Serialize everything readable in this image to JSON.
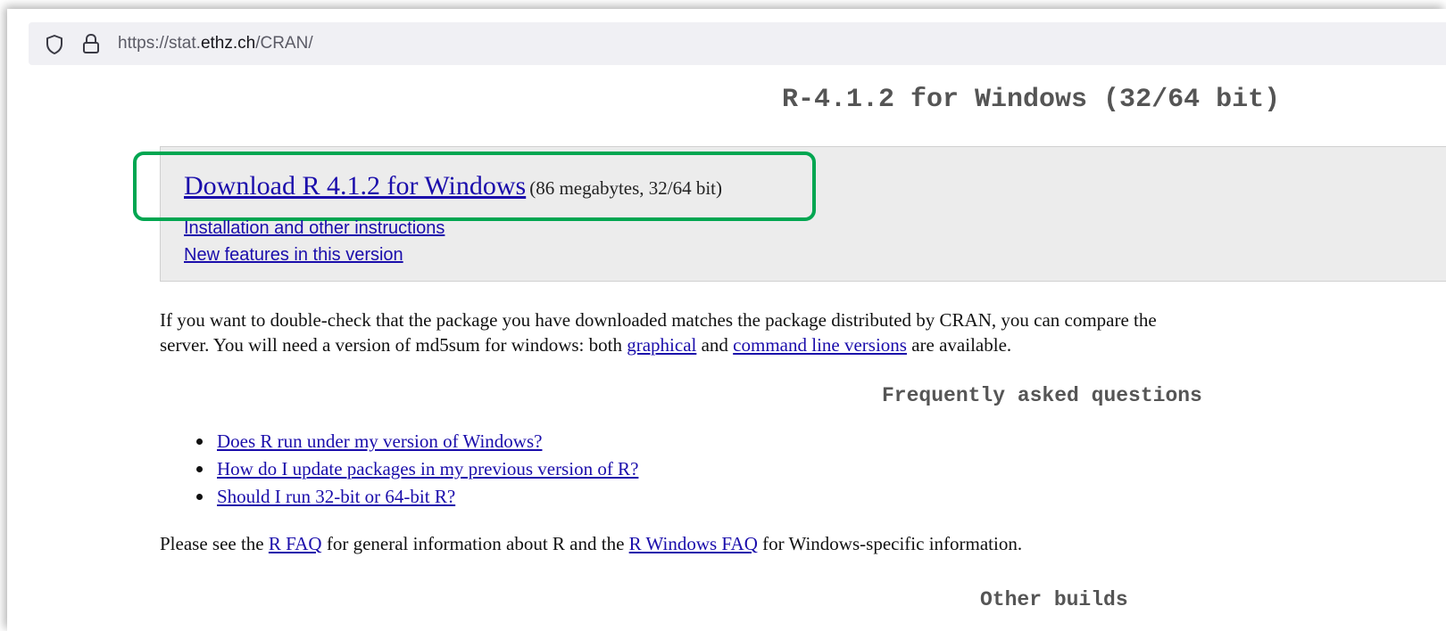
{
  "browser": {
    "url_prefix": "https://stat.",
    "url_host": "ethz.ch",
    "url_path": "/CRAN/"
  },
  "page": {
    "title": "R-4.1.2 for Windows (32/64 bit)",
    "download": {
      "link_label": "Download R 4.1.2 for Windows",
      "size_note": "(86 megabytes, 32/64 bit)"
    },
    "install_link": "Installation and other instructions",
    "features_link": "New features in this version",
    "md5_paragraph": {
      "line1": "If you want to double-check that the package you have downloaded matches the package distributed by CRAN, you can compare the",
      "line2_pre": "server. You will need a version of md5sum for windows: both ",
      "link_graphical": "graphical",
      "line2_mid": " and ",
      "link_cmdline": "command line versions",
      "line2_post": " are available."
    },
    "faq_heading": "Frequently asked questions",
    "faq_items": [
      "Does R run under my version of Windows?",
      "How do I update packages in my previous version of R?",
      "Should I run 32-bit or 64-bit R?"
    ],
    "faq_paragraph": {
      "pre": "Please see the ",
      "link_rfaq": "R FAQ",
      "mid": " for general information about R and the ",
      "link_winfaq": "R Windows FAQ",
      "post": " for Windows-specific information."
    },
    "other_builds_heading": "Other builds"
  },
  "colors": {
    "link": "#1a0dab",
    "highlight": "#00a651",
    "heading": "#555555",
    "box_bg": "#ececec"
  }
}
